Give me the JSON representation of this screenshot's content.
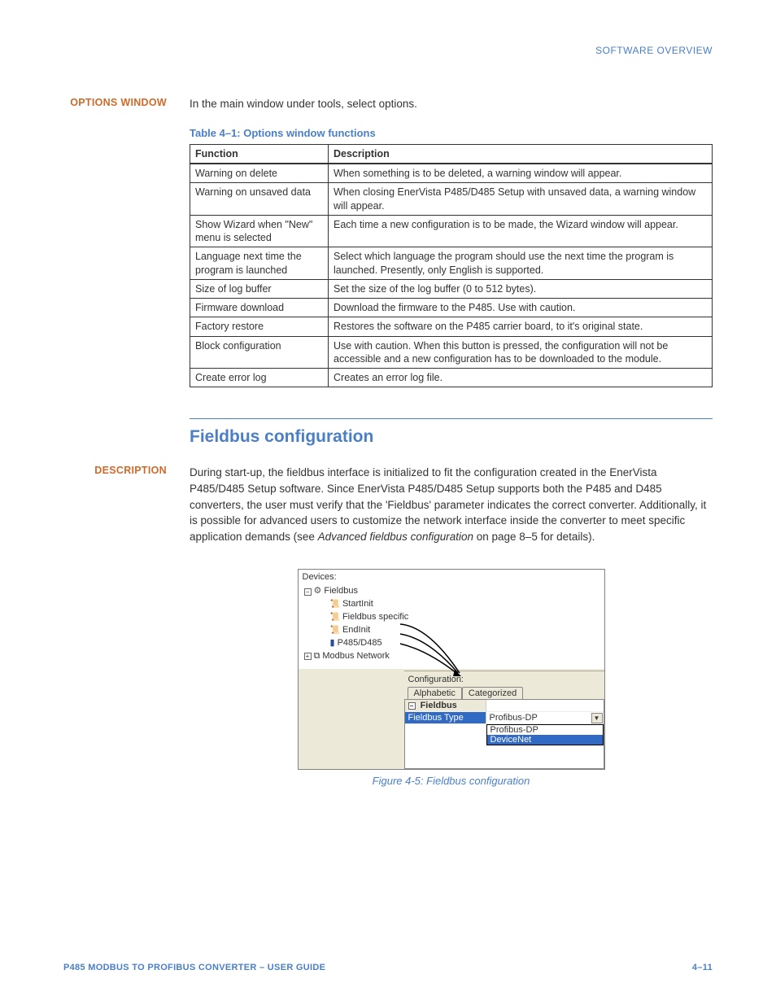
{
  "header": {
    "breadcrumb": "SOFTWARE OVERVIEW"
  },
  "options_window": {
    "sidebar_label": "OPTIONS WINDOW",
    "intro": "In the main window under tools, select options.",
    "table_caption": "Table 4–1: Options window functions",
    "columns": {
      "function": "Function",
      "description": "Description"
    },
    "rows": [
      {
        "fn": "Warning on delete",
        "desc": "When something is to be deleted, a warning window will appear."
      },
      {
        "fn": "Warning on unsaved data",
        "desc": "When closing EnerVista P485/D485 Setup with unsaved data, a warning window will appear."
      },
      {
        "fn": "Show Wizard when \"New\" menu is selected",
        "desc": "Each time a new configuration is to be made, the Wizard window will appear."
      },
      {
        "fn": "Language next time the program is launched",
        "desc": "Select which language the program should use the next time the program is launched. Presently, only English is supported."
      },
      {
        "fn": "Size of log buffer",
        "desc": "Set the size of the log buffer (0 to 512 bytes)."
      },
      {
        "fn": "Firmware download",
        "desc": "Download the firmware to the P485. Use with caution."
      },
      {
        "fn": "Factory restore",
        "desc": "Restores the software on the P485 carrier board, to it's original state."
      },
      {
        "fn": "Block configuration",
        "desc": "Use with caution. When this button is pressed, the configuration will not be accessible and a new configuration has to be downloaded to the module."
      },
      {
        "fn": "Create error log",
        "desc": "Creates an error log file."
      }
    ]
  },
  "fieldbus": {
    "heading": "Fieldbus configuration",
    "sidebar_label": "DESCRIPTION",
    "para_a": "During start-up, the fieldbus interface is initialized to fit the configuration created in the EnerVista P485/D485 Setup software. Since EnerVista P485/D485 Setup supports both the P485 and D485 converters, the user must verify that the 'Fieldbus' parameter indicates the correct converter. Additionally, it is possible for advanced users to customize the network interface inside the converter to meet specific application demands (see ",
    "para_italic": "Advanced fieldbus configuration",
    "para_b": " on page 8–5 for details).",
    "figure_caption": "Figure 4-5: Fieldbus configuration",
    "screenshot": {
      "devices_label": "Devices:",
      "tree": {
        "root": "Fieldbus",
        "children": [
          "StartInit",
          "Fieldbus specific",
          "EndInit",
          "P485/D485"
        ],
        "sibling": "Modbus Network"
      },
      "config_label": "Configuration:",
      "tabs": {
        "a": "Alphabetic",
        "b": "Categorized"
      },
      "group": "Fieldbus",
      "prop_key": "Fieldbus Type",
      "prop_val": "Profibus-DP",
      "options": [
        "Profibus-DP",
        "DeviceNet"
      ]
    }
  },
  "footer": {
    "left": "P485 MODBUS TO PROFIBUS CONVERTER – USER GUIDE",
    "right": "4–11"
  }
}
